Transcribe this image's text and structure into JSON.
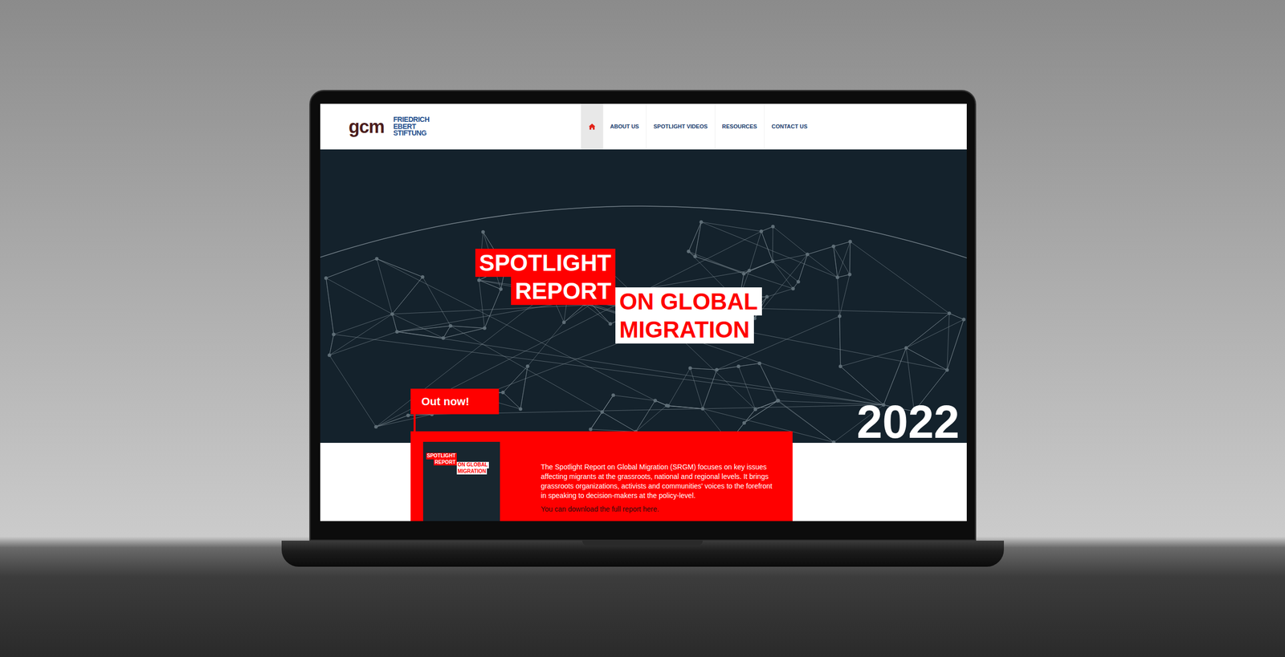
{
  "header": {
    "logos": {
      "gcm": "gcm",
      "fes": [
        "FRIEDRICH",
        "EBERT",
        "STIFTUNG"
      ]
    },
    "nav": [
      {
        "kind": "icon",
        "selected": true
      },
      {
        "kind": "text",
        "label": "ABOUT US",
        "selected": false
      },
      {
        "kind": "text",
        "label": "SPOTLIGHT VIDEOS",
        "selected": false
      },
      {
        "kind": "text",
        "label": "RESOURCES",
        "selected": false
      },
      {
        "kind": "text",
        "label": "CONTACT US",
        "selected": false
      }
    ]
  },
  "hero": {
    "title_red": [
      "SPOTLIGHT",
      "REPORT"
    ],
    "title_white": [
      "ON GLOBAL",
      "MIGRATION"
    ],
    "year": "2022"
  },
  "feature": {
    "badge": "Out now!",
    "cover": {
      "title_red": [
        "SPOTLIGHT",
        "REPORT"
      ],
      "title_white": [
        "ON GLOBAL",
        "MIGRATION"
      ]
    },
    "description": "The Spotlight Report on Global Migration (SRGM) focuses on key issues affecting migrants at the grassroots, national and regional levels. It brings grassroots organizations, activists and communities' voices to the forefront in speaking to decision-makers at the policy-level.",
    "link": "You can download the full report here."
  }
}
